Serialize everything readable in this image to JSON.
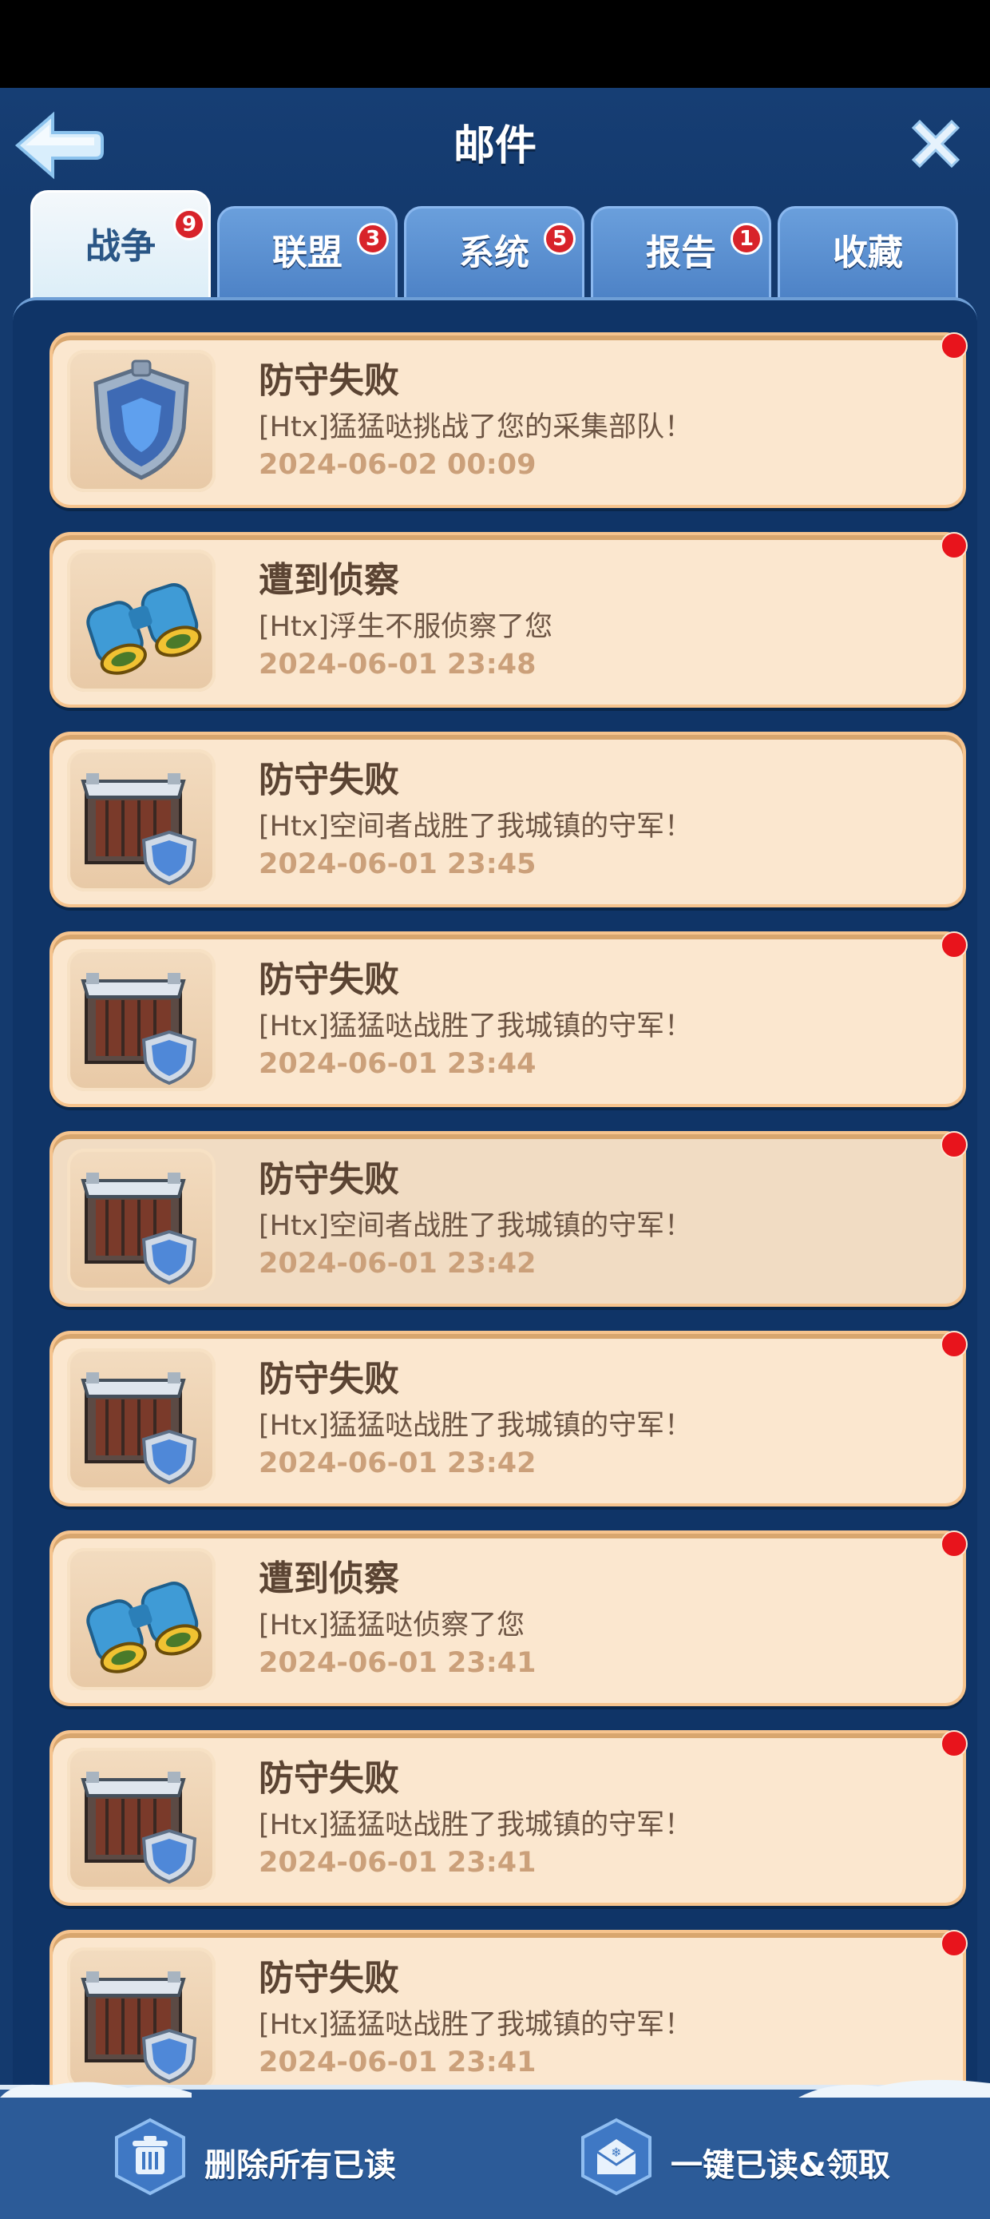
{
  "window": {
    "title": "邮件"
  },
  "tabs": [
    {
      "label": "战争",
      "badge": "9",
      "active": true
    },
    {
      "label": "联盟",
      "badge": "3",
      "active": false
    },
    {
      "label": "系统",
      "badge": "5",
      "active": false
    },
    {
      "label": "报告",
      "badge": "1",
      "active": false
    },
    {
      "label": "收藏",
      "badge": "",
      "active": false
    }
  ],
  "mails": [
    {
      "icon": "shield-icon",
      "title": "防守失败",
      "desc": "[Htx]猛猛哒挑战了您的采集部队！",
      "time": "2024-06-02 00:09",
      "unread": true
    },
    {
      "icon": "binoculars-icon",
      "title": "遭到侦察",
      "desc": "[Htx]浮生不服侦察了您",
      "time": "2024-06-01 23:48",
      "unread": true
    },
    {
      "icon": "fortress-icon",
      "title": "防守失败",
      "desc": "[Htx]空间者战胜了我城镇的守军！",
      "time": "2024-06-01 23:45",
      "unread": false
    },
    {
      "icon": "fortress-icon",
      "title": "防守失败",
      "desc": "[Htx]猛猛哒战胜了我城镇的守军！",
      "time": "2024-06-01 23:44",
      "unread": true
    },
    {
      "icon": "fortress-icon",
      "title": "防守失败",
      "desc": "[Htx]空间者战胜了我城镇的守军！",
      "time": "2024-06-01 23:42",
      "unread": true
    },
    {
      "icon": "fortress-icon",
      "title": "防守失败",
      "desc": "[Htx]猛猛哒战胜了我城镇的守军！",
      "time": "2024-06-01 23:42",
      "unread": true
    },
    {
      "icon": "binoculars-icon",
      "title": "遭到侦察",
      "desc": "[Htx]猛猛哒侦察了您",
      "time": "2024-06-01 23:41",
      "unread": true
    },
    {
      "icon": "fortress-icon",
      "title": "防守失败",
      "desc": "[Htx]猛猛哒战胜了我城镇的守军！",
      "time": "2024-06-01 23:41",
      "unread": true
    },
    {
      "icon": "fortress-icon",
      "title": "防守失败",
      "desc": "[Htx]猛猛哒战胜了我城镇的守军！",
      "time": "2024-06-01 23:41",
      "unread": true
    }
  ],
  "footer": {
    "delete_label": "删除所有已读",
    "read_all_label": "一键已读&领取"
  },
  "colors": {
    "background": "#143a6e",
    "card": "#fbe7cf",
    "unread_dot": "#e8141c"
  }
}
